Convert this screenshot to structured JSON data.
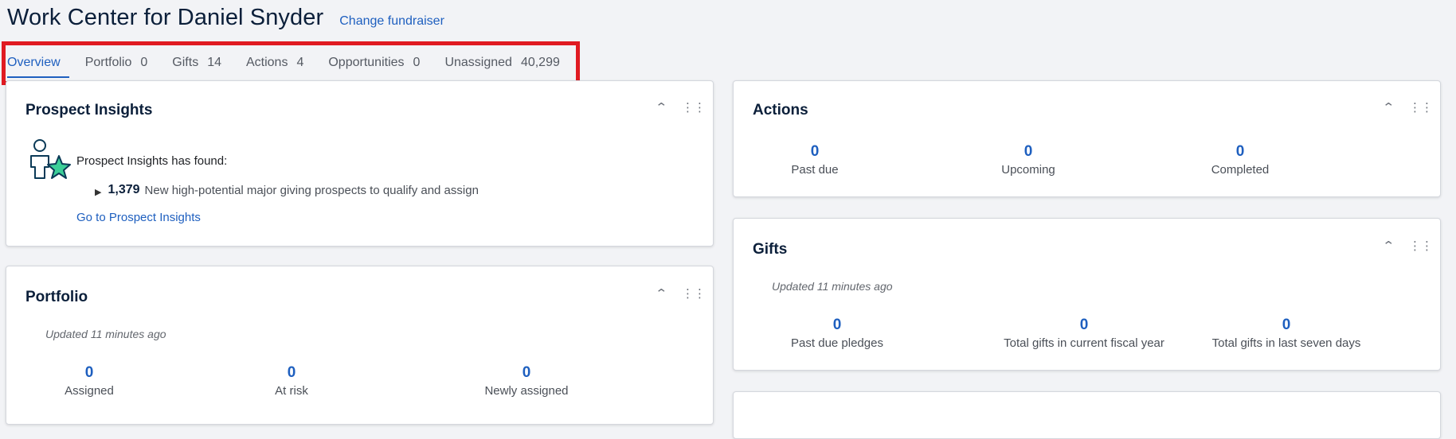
{
  "header": {
    "title": "Work Center for Daniel Snyder",
    "change_link": "Change fundraiser"
  },
  "tabs": [
    {
      "label": "Overview",
      "count": "",
      "active": true
    },
    {
      "label": "Portfolio",
      "count": "0"
    },
    {
      "label": "Gifts",
      "count": "14"
    },
    {
      "label": "Actions",
      "count": "4"
    },
    {
      "label": "Opportunities",
      "count": "0"
    },
    {
      "label": "Unassigned",
      "count": "40,299"
    }
  ],
  "colors": {
    "accent": "#1e5fbf",
    "highlight": "#e01b22",
    "title": "#0b1f3a",
    "background": "#f2f3f6"
  },
  "icons": [
    "chevron-up-icon",
    "drag-handle-icon",
    "prospect-star-icon",
    "caret-right-icon"
  ],
  "prospect_insights": {
    "title": "Prospect Insights",
    "found_text": "Prospect Insights has found:",
    "count": "1,379",
    "description": "New high-potential major giving prospects to qualify and assign",
    "link": "Go to Prospect Insights"
  },
  "portfolio": {
    "title": "Portfolio",
    "updated": "Updated 11 minutes ago",
    "stats": [
      {
        "value": "0",
        "label": "Assigned"
      },
      {
        "value": "0",
        "label": "At risk"
      },
      {
        "value": "0",
        "label": "Newly assigned"
      }
    ]
  },
  "actions": {
    "title": "Actions",
    "stats": [
      {
        "value": "0",
        "label": "Past due"
      },
      {
        "value": "0",
        "label": "Upcoming"
      },
      {
        "value": "0",
        "label": "Completed"
      }
    ]
  },
  "gifts": {
    "title": "Gifts",
    "updated": "Updated 11 minutes ago",
    "stats": [
      {
        "value": "0",
        "label": "Past due pledges"
      },
      {
        "value": "0",
        "label": "Total gifts in current fiscal year"
      },
      {
        "value": "0",
        "label": "Total gifts in last seven days"
      }
    ]
  }
}
